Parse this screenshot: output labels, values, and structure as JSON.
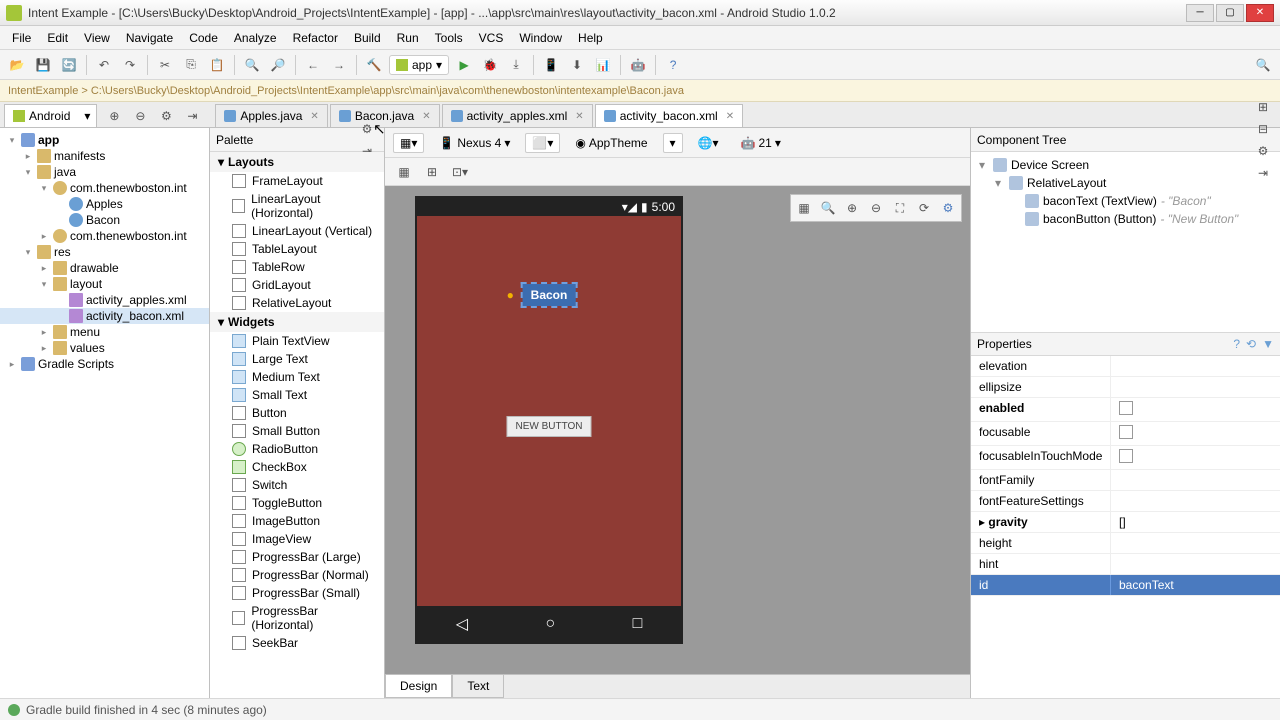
{
  "title": "Intent Example - [C:\\Users\\Bucky\\Desktop\\Android_Projects\\IntentExample] - [app] - ...\\app\\src\\main\\res\\layout\\activity_bacon.xml - Android Studio 1.0.2",
  "menu": [
    "File",
    "Edit",
    "View",
    "Navigate",
    "Code",
    "Analyze",
    "Refactor",
    "Build",
    "Run",
    "Tools",
    "VCS",
    "Window",
    "Help"
  ],
  "run_config": "app",
  "breadcrumb": "IntentExample > C:\\Users\\Bucky\\Desktop\\Android_Projects\\IntentExample\\app\\src\\main\\java\\com\\thenewboston\\intentexample\\Bacon.java",
  "project_tab": "Android",
  "editor_tabs": [
    {
      "label": "Apples.java",
      "active": false
    },
    {
      "label": "Bacon.java",
      "active": false
    },
    {
      "label": "activity_apples.xml",
      "active": false
    },
    {
      "label": "activity_bacon.xml",
      "active": true
    }
  ],
  "project_tree": [
    {
      "d": 0,
      "t": "▾",
      "ic": "ic-mod",
      "label": "app",
      "b": true
    },
    {
      "d": 1,
      "t": "▸",
      "ic": "ic-folder",
      "label": "manifests"
    },
    {
      "d": 1,
      "t": "▾",
      "ic": "ic-folder",
      "label": "java"
    },
    {
      "d": 2,
      "t": "▾",
      "ic": "ic-pkg",
      "label": "com.thenewboston.int"
    },
    {
      "d": 3,
      "t": "",
      "ic": "ic-java",
      "label": "Apples"
    },
    {
      "d": 3,
      "t": "",
      "ic": "ic-java",
      "label": "Bacon"
    },
    {
      "d": 2,
      "t": "▸",
      "ic": "ic-pkg",
      "label": "com.thenewboston.int"
    },
    {
      "d": 1,
      "t": "▾",
      "ic": "ic-folder",
      "label": "res"
    },
    {
      "d": 2,
      "t": "▸",
      "ic": "ic-folder",
      "label": "drawable"
    },
    {
      "d": 2,
      "t": "▾",
      "ic": "ic-folder",
      "label": "layout"
    },
    {
      "d": 3,
      "t": "",
      "ic": "ic-xml",
      "label": "activity_apples.xml"
    },
    {
      "d": 3,
      "t": "",
      "ic": "ic-xml",
      "label": "activity_bacon.xml",
      "sel": true
    },
    {
      "d": 2,
      "t": "▸",
      "ic": "ic-folder",
      "label": "menu"
    },
    {
      "d": 2,
      "t": "▸",
      "ic": "ic-folder",
      "label": "values"
    },
    {
      "d": 0,
      "t": "▸",
      "ic": "ic-mod",
      "label": "Gradle Scripts"
    }
  ],
  "palette": {
    "title": "Palette",
    "groups": [
      {
        "name": "Layouts",
        "items": [
          "FrameLayout",
          "LinearLayout (Horizontal)",
          "LinearLayout (Vertical)",
          "TableLayout",
          "TableRow",
          "GridLayout",
          "RelativeLayout"
        ]
      },
      {
        "name": "Widgets",
        "items": [
          "Plain TextView",
          "Large Text",
          "Medium Text",
          "Small Text",
          "Button",
          "Small Button",
          "RadioButton",
          "CheckBox",
          "Switch",
          "ToggleButton",
          "ImageButton",
          "ImageView",
          "ProgressBar (Large)",
          "ProgressBar (Normal)",
          "ProgressBar (Small)",
          "ProgressBar (Horizontal)",
          "SeekBar"
        ]
      }
    ]
  },
  "design_toolbar": {
    "device": "Nexus 4",
    "theme": "AppTheme",
    "api": "21"
  },
  "device": {
    "time": "5:00",
    "text_widget": "Bacon",
    "button_widget": "NEW BUTTON"
  },
  "design_tabs": {
    "design": "Design",
    "text": "Text"
  },
  "component_tree": {
    "title": "Component Tree",
    "items": [
      {
        "d": 0,
        "label": "Device Screen"
      },
      {
        "d": 1,
        "label": "RelativeLayout"
      },
      {
        "d": 2,
        "label": "baconText (TextView)",
        "hint": "\"Bacon\""
      },
      {
        "d": 2,
        "label": "baconButton (Button)",
        "hint": "\"New Button\""
      }
    ]
  },
  "properties": {
    "title": "Properties",
    "rows": [
      {
        "name": "elevation",
        "val": ""
      },
      {
        "name": "ellipsize",
        "val": ""
      },
      {
        "name": "enabled",
        "type": "check",
        "b": true
      },
      {
        "name": "focusable",
        "type": "check"
      },
      {
        "name": "focusableInTouchMode",
        "type": "check"
      },
      {
        "name": "fontFamily",
        "val": ""
      },
      {
        "name": "fontFeatureSettings",
        "val": ""
      },
      {
        "name": "gravity",
        "val": "[]",
        "b": true,
        "exp": true
      },
      {
        "name": "height",
        "val": ""
      },
      {
        "name": "hint",
        "val": ""
      },
      {
        "name": "id",
        "val": "baconText",
        "sel": true
      }
    ]
  },
  "status": "Gradle build finished in 4 sec (8 minutes ago)"
}
